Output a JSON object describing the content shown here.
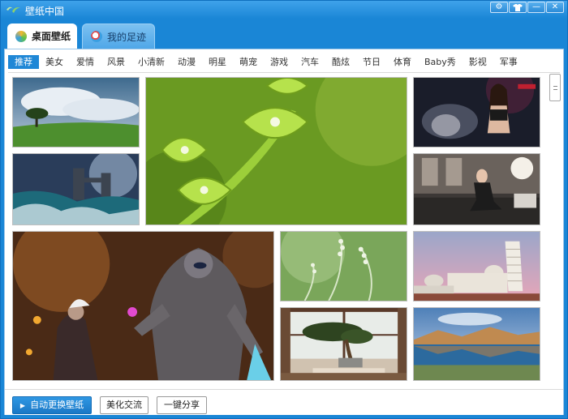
{
  "window": {
    "title": "壁纸中国",
    "controls": [
      "gear-icon",
      "shirt-icon",
      "minimize-icon",
      "close-icon"
    ]
  },
  "tabs": [
    {
      "label": "桌面壁纸",
      "active": true
    },
    {
      "label": "我的足迹",
      "active": false
    }
  ],
  "categories": [
    "推荐",
    "美女",
    "爱情",
    "风景",
    "小清新",
    "动漫",
    "明星",
    "萌宠",
    "游戏",
    "汽车",
    "酷炫",
    "节日",
    "体育",
    "Baby秀",
    "影视",
    "军事"
  ],
  "active_category": "推荐",
  "gallery": {
    "items": [
      {
        "name": "tile-tree-meadow",
        "subject": "tree-meadow"
      },
      {
        "name": "tile-green-plant",
        "subject": "green-plant"
      },
      {
        "name": "tile-motorbike-girl",
        "subject": "motorbike-girl"
      },
      {
        "name": "tile-castle-waves",
        "subject": "castle-waves"
      },
      {
        "name": "tile-city-girl",
        "subject": "city-girl"
      },
      {
        "name": "tile-game-warrior",
        "subject": "game-warrior"
      },
      {
        "name": "tile-grass-flowers",
        "subject": "grass-flowers"
      },
      {
        "name": "tile-pisa-tower",
        "subject": "pisa-tower"
      },
      {
        "name": "tile-bonsai-window",
        "subject": "bonsai-window"
      },
      {
        "name": "tile-lake-mountains",
        "subject": "lake-mountains"
      }
    ]
  },
  "buttons": {
    "auto_change": "自动更换壁纸",
    "beautify": "美化交流",
    "share": "一键分享"
  },
  "colors": {
    "titlebar": "#1a86d6",
    "accent": "#1f87d6",
    "panel": "#ffffff"
  }
}
